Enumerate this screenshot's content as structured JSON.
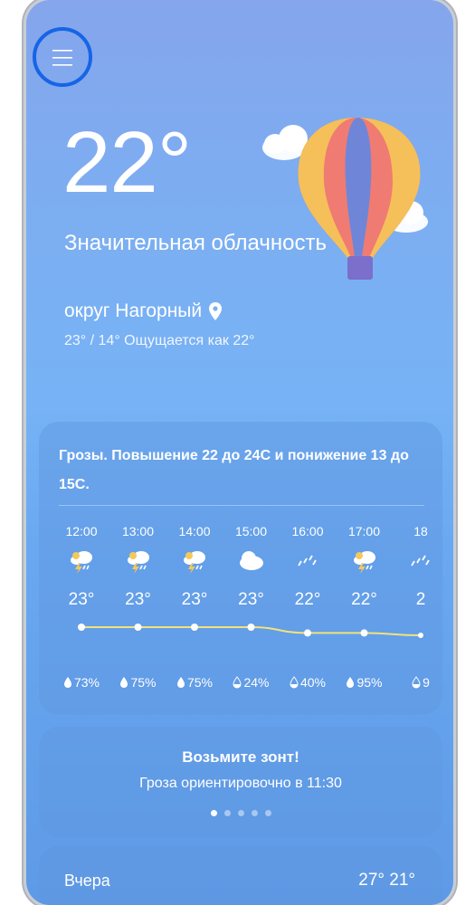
{
  "current": {
    "temperature": "22°",
    "condition": "Значительная облачность",
    "location": "округ Нагорный",
    "range_feels": "23° / 14° Ощущается как 22°"
  },
  "hourly": {
    "summary": "Грозы. Повышение 22 до 24С и понижение 13 до 15С.",
    "hours": [
      {
        "time": "12:00",
        "icon": "thunderstorm-icon",
        "temp": "23°",
        "precip": "73%",
        "temp_value": 23
      },
      {
        "time": "13:00",
        "icon": "thunderstorm-icon",
        "temp": "23°",
        "precip": "75%",
        "temp_value": 23
      },
      {
        "time": "14:00",
        "icon": "thunderstorm-icon",
        "temp": "23°",
        "precip": "75%",
        "temp_value": 23
      },
      {
        "time": "15:00",
        "icon": "cloud-icon",
        "temp": "23°",
        "precip": "24%",
        "temp_value": 23
      },
      {
        "time": "16:00",
        "icon": "rain-icon",
        "temp": "22°",
        "precip": "40%",
        "temp_value": 22
      },
      {
        "time": "17:00",
        "icon": "thunderstorm-icon",
        "temp": "22°",
        "precip": "95%",
        "temp_value": 22
      },
      {
        "time": "18",
        "icon": "rain-icon",
        "temp": "2",
        "precip": "9",
        "temp_value": 21.6
      }
    ]
  },
  "advice": {
    "title": "Возьмите зонт!",
    "text": "Гроза ориентировочно в 11:30",
    "page_count": 5,
    "active_page": 0
  },
  "yesterday": {
    "label": "Вчера",
    "temps": "27° 21°"
  },
  "colors": {
    "accent_ring": "#1565e6",
    "temp_line": "#f3e27a"
  }
}
